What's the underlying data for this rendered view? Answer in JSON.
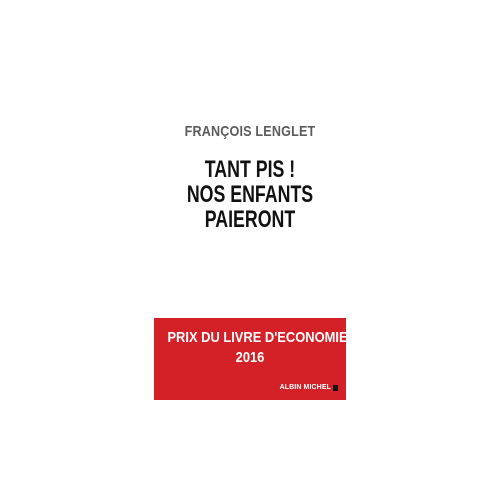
{
  "cover": {
    "author": "FRANÇOIS LENGLET",
    "title_lines": [
      "TANT PIS !",
      "NOS ENFANTS",
      "PAIERONT"
    ],
    "prize_lines": [
      "PRIX DU LIVRE D'ECONOMIE",
      "2016"
    ],
    "publisher": "ALBIN MICHEL",
    "colors": {
      "band": "#d42128",
      "title": "#111111",
      "author": "#5b5b5b"
    }
  }
}
